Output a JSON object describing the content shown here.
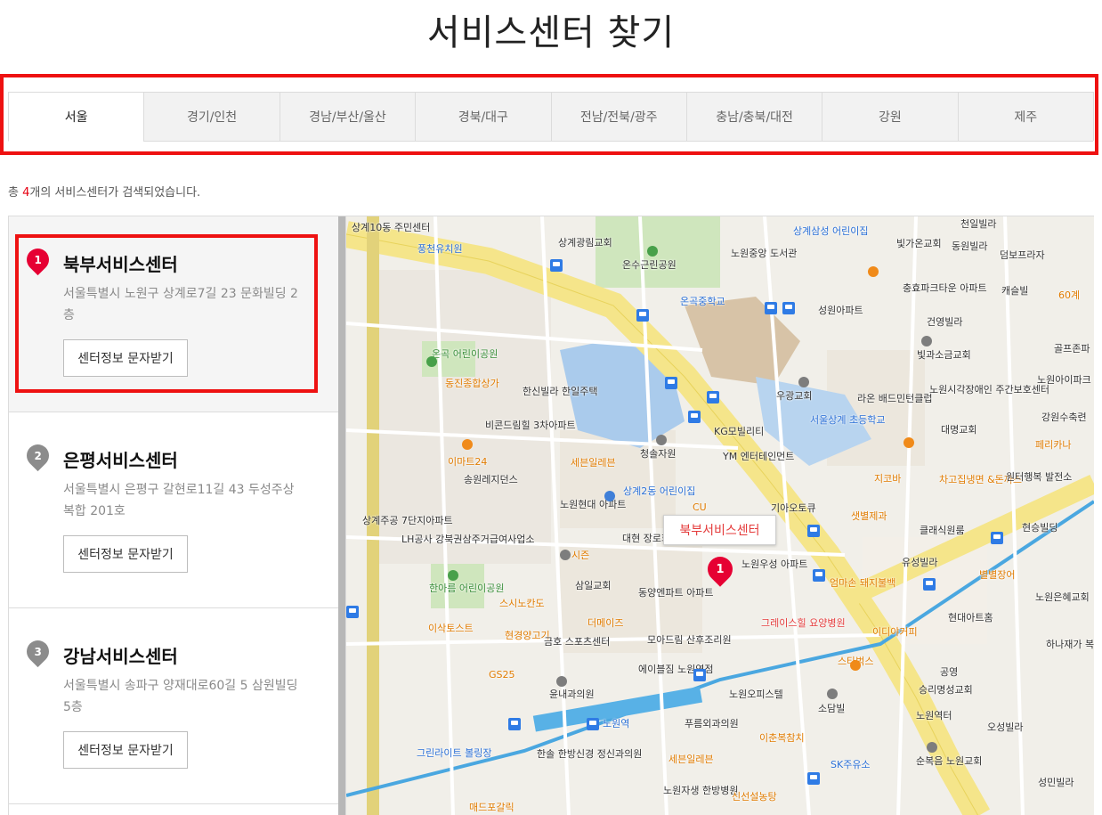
{
  "page": {
    "title": "서비스센터 찾기"
  },
  "regions": {
    "tabs": [
      {
        "label": "서울",
        "active": true
      },
      {
        "label": "경기/인천",
        "active": false
      },
      {
        "label": "경남/부산/울산",
        "active": false
      },
      {
        "label": "경북/대구",
        "active": false
      },
      {
        "label": "전남/전북/광주",
        "active": false
      },
      {
        "label": "충남/충북/대전",
        "active": false
      },
      {
        "label": "강원",
        "active": false
      },
      {
        "label": "제주",
        "active": false
      }
    ]
  },
  "results": {
    "prefix": "총 ",
    "count": "4",
    "suffix": "개의 서비스센터가 검색되었습니다."
  },
  "centers": [
    {
      "number": "1",
      "name": "북부서비스센터",
      "address": "서울특별시 노원구 상계로7길 23 문화빌딩 2층",
      "button": "센터정보 문자받기",
      "selected": true
    },
    {
      "number": "2",
      "name": "은평서비스센터",
      "address": "서울특별시 은평구 갈현로11길 43 두성주상복합 201호",
      "button": "센터정보 문자받기",
      "selected": false
    },
    {
      "number": "3",
      "name": "강남서비스센터",
      "address": "서울특별시 송파구 양재대로60길 5 삼원빌딩 5층",
      "button": "센터정보 문자받기",
      "selected": false
    }
  ],
  "map": {
    "popup": "북부서비스센터",
    "marker_number": "1",
    "labels": [
      "상계10동 주민센터",
      "풍천유치원",
      "상계광림교회",
      "온수근린공원",
      "노원중앙 도서관",
      "상계삼성 어린이집",
      "빛가온교회",
      "동원빌라",
      "천일빌라",
      "덤보프라자",
      "온곡중학교",
      "성원아파트",
      "충효파크타운 아파트",
      "캐슬빌",
      "60계",
      "건영빌라",
      "골프존파",
      "노원아이파크 아파트",
      "빛과소금교회",
      "노원시각장애인 주간보호센터",
      "강원수축련",
      "우광교회",
      "라온 배드민턴클럽",
      "서울상계 초등학교",
      "대명교회",
      "페리카나",
      "KG모빌리티",
      "YM 엔터테인먼트",
      "청솔자원",
      "세븐일레븐",
      "상계2동 어린이집",
      "노원현대 아파트",
      "CU",
      "지코바",
      "차고집냉면 &돈까스",
      "원터행복 발전소",
      "기아오토큐",
      "샛별제과",
      "클래식원룸",
      "현승빌딩",
      "유성빌라",
      "별별장어",
      "노원은혜교회",
      "노원우성 아파트",
      "엄마손 돼지불백",
      "동양엔파트 아파트",
      "삼일교회",
      "시즌",
      "스시노칸도",
      "더메이즈",
      "현대아트홈",
      "하나재가 복지센터",
      "그레이스힐 요양병원",
      "이디야커피",
      "스타벅스",
      "공영",
      "승리명성교회",
      "이삭토스트",
      "현경양고기",
      "금호 스포츠센터",
      "모아드림 산후조리원",
      "에이블짐 노원역점",
      "노원오피스텔",
      "소담빌",
      "윤내과의원",
      "GS25",
      "노원역",
      "푸름외과의원",
      "이춘복참치",
      "노원역터",
      "오성빌라",
      "그린라이트 볼링장",
      "한솔 한방신경 정신과의원",
      "세븐일레븐",
      "SK주유소",
      "순복음 노원교회",
      "노원자생 한방병원",
      "신선설농탕",
      "매드포갈릭",
      "성민빌라",
      "온곡 어린이공원",
      "동진종합상가",
      "한신빌라 한일주택",
      "비콘드림힐 3차아파트",
      "이마트24",
      "송원레지던스",
      "상계주공 7단지아파트",
      "LH공사 강북권삼주거급여사업소",
      "한아름 어린이공원",
      "대현 장로회 창대교회"
    ]
  }
}
